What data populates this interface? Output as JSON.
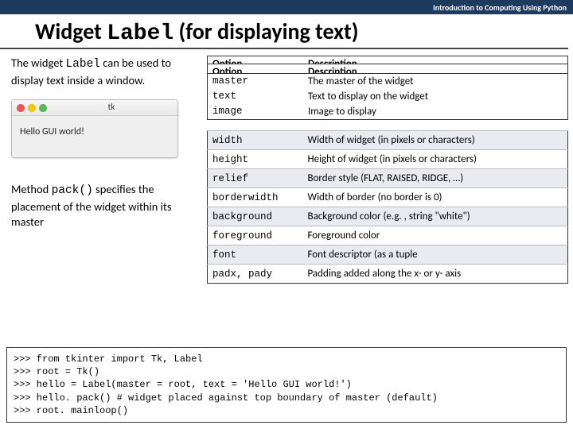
{
  "course_header": "Introduction to Computing Using Python",
  "title_prefix": "Widget ",
  "title_code": "Label",
  "title_suffix": " (for displaying text)",
  "intro_prefix": "The widget ",
  "intro_code": "Label",
  "intro_suffix": " can be used to display text inside a window.",
  "method_prefix": "Method ",
  "method_code": "pack()",
  "method_suffix": " specifies the placement of the widget within its master",
  "mini_window": {
    "title": "tk",
    "body": "Hello GUI world!"
  },
  "overlay_headers": {
    "option": "Option",
    "description": "Description"
  },
  "overlay_rows1": [
    {
      "option": "master",
      "description": "The master of the widget"
    },
    {
      "option": "text",
      "description": "Text to display on the widget"
    }
  ],
  "overlay_rows2": [
    {
      "option": "master",
      "description": "The master of the widget"
    },
    {
      "option": "text",
      "description": "Text to display on the widget"
    },
    {
      "option": "image",
      "description": "Image to display"
    }
  ],
  "main_table": [
    {
      "option": "width",
      "description": "Width of widget (in pixels or characters)"
    },
    {
      "option": "height",
      "description": "Height of widget (in pixels or characters)"
    },
    {
      "option": "relief",
      "description": "Border style (FLAT, RAISED, RIDGE, …)"
    },
    {
      "option": "borderwidth",
      "description": "Width of border (no border is 0)"
    },
    {
      "option": "background",
      "description": "Background color (e.g. , string \"white\")"
    },
    {
      "option": "foreground",
      "description": "Foreground color"
    },
    {
      "option": "font",
      "description": "Font descriptor (as a tuple"
    },
    {
      "option": "padx, pady",
      "description": "Padding added along the x- or y- axis"
    }
  ],
  "code": ">>> from tkinter import Tk, Label\n>>> root = Tk()\n>>> hello = Label(master = root, text = 'Hello GUI world!')\n>>> hello. pack() # widget placed against top boundary of master (default)\n>>> root. mainloop()"
}
